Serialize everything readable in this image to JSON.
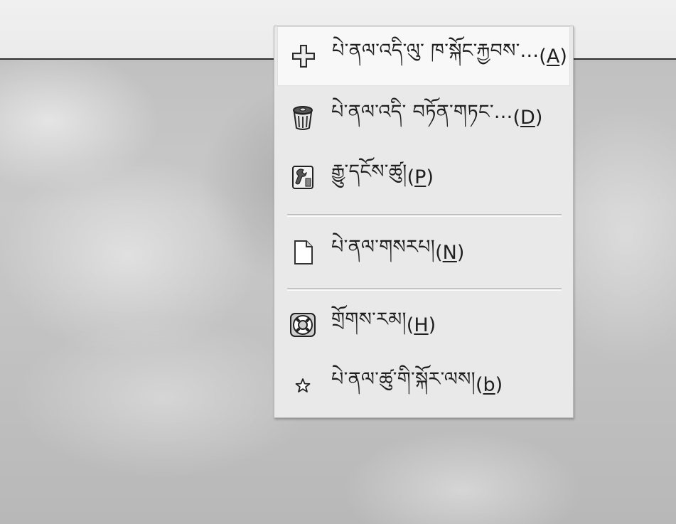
{
  "panel_menu": {
    "items": [
      {
        "id": "add",
        "label": "པེ་ནལ་འདི་ལུ་ ཁ་སྐོང་རྐྱབས་...",
        "accel_open": "(",
        "accel_key": "A",
        "accel_close": ")",
        "icon": "plus-icon",
        "highlighted": true
      },
      {
        "id": "delete",
        "label": "པེ་ནལ་འདི་ བཏོན་གཏང་...",
        "accel_open": "(",
        "accel_key": "D",
        "accel_close": ")",
        "icon": "trash-icon"
      },
      {
        "id": "properties",
        "label": "རྒྱུ་དངོས་ཚུ།",
        "accel_open": "(",
        "accel_key": "P",
        "accel_close": ")",
        "icon": "properties-icon"
      },
      {
        "id": "new",
        "label": "པེ་ནལ་གསརཔ།",
        "accel_open": "(",
        "accel_key": "N",
        "accel_close": ")",
        "icon": "new-document-icon"
      },
      {
        "id": "help",
        "label": "གྲོགས་རམ།",
        "accel_open": "(",
        "accel_key": "H",
        "accel_close": ")",
        "icon": "help-lifebuoy-icon"
      },
      {
        "id": "about",
        "label": "པེ་ནལ་ཚུ་གི་སྐོར་ལས།",
        "accel_open": "(",
        "accel_key": "b",
        "accel_close": ")",
        "icon": "star-icon"
      }
    ]
  },
  "colors": {
    "menu_bg": "#e9e9e9",
    "highlight_bg": "#f8f8f8",
    "panel_bg": "#ebebeb",
    "text": "#1f1f1f"
  }
}
